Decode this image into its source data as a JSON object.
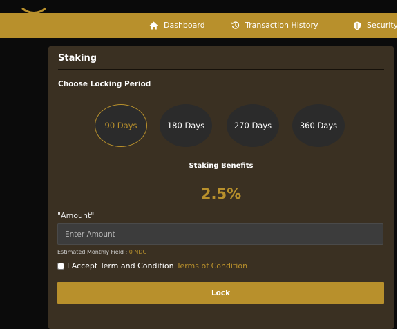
{
  "nav": {
    "items": [
      {
        "label": "Dashboard",
        "icon": "home-icon"
      },
      {
        "label": "Transaction History",
        "icon": "history-icon"
      },
      {
        "label": "Security",
        "icon": "shield-icon"
      }
    ]
  },
  "staking": {
    "title": "Staking",
    "choose_label": "Choose Locking Period",
    "periods": [
      "90 Days",
      "180 Days",
      "270 Days",
      "360 Days"
    ],
    "selected_period": "90 Days",
    "benefits_label": "Staking Benefits",
    "rate": "2.5%",
    "amount_label": "\"Amount\"",
    "amount_placeholder": "Enter Amount",
    "amount_value": "",
    "estimate_label": "Estimated Monthly Field :",
    "estimate_value": "0 NDC",
    "terms_text": "I Accept Term and Condition",
    "terms_link": "Terms of Condition",
    "terms_checked": false,
    "lock_label": "Lock"
  },
  "colors": {
    "accent": "#b8902c",
    "card": "#3a3022",
    "page_bg": "#0b0b0b"
  }
}
